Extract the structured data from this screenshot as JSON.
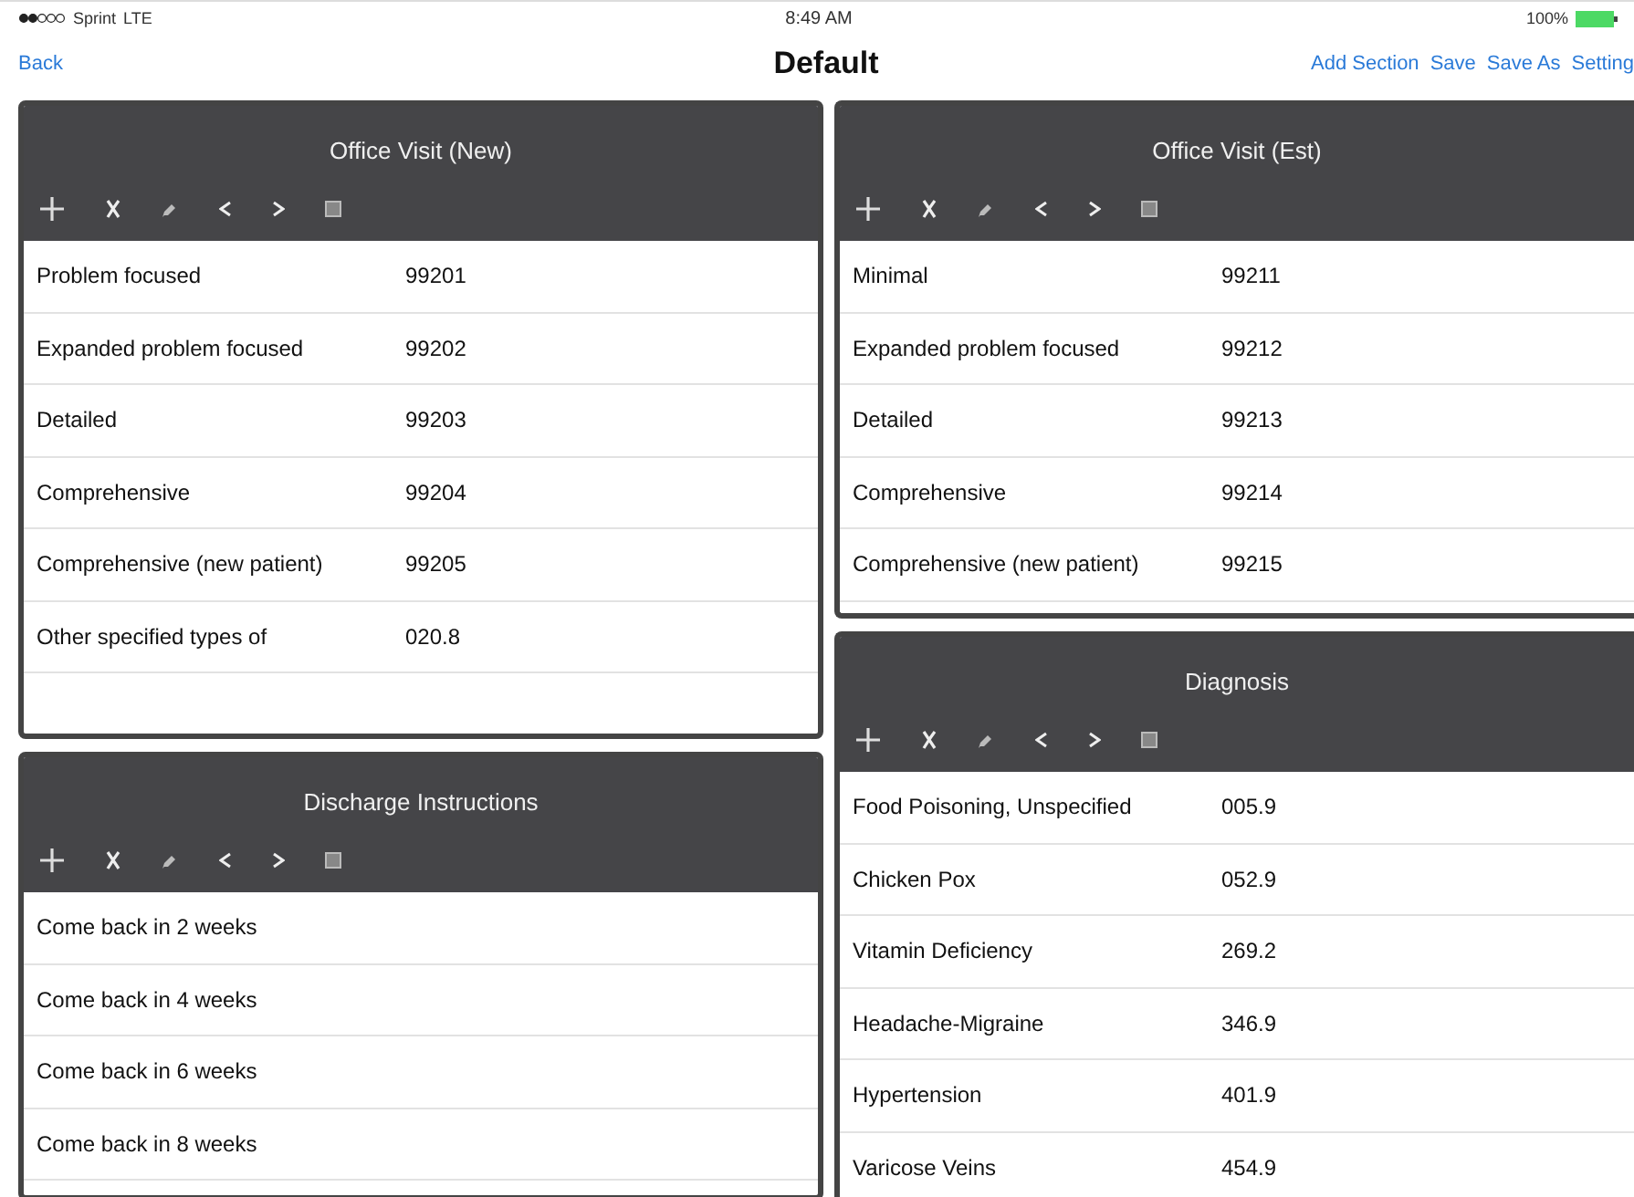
{
  "status_bar": {
    "carrier": "Sprint",
    "network": "LTE",
    "time": "8:49 AM",
    "battery": "100%"
  },
  "nav": {
    "back": "Back",
    "title": "Default",
    "actions": [
      "Add Section",
      "Save",
      "Save As",
      "Setting"
    ]
  },
  "columns": [
    {
      "panels": [
        {
          "title": "Office Visit (New)",
          "rows": [
            {
              "label": "Problem focused",
              "code": "99201"
            },
            {
              "label": "Expanded problem focused",
              "code": "99202"
            },
            {
              "label": "Detailed",
              "code": "99203"
            },
            {
              "label": "Comprehensive",
              "code": "99204"
            },
            {
              "label": "Comprehensive (new patient)",
              "code": "99205"
            },
            {
              "label": "Other specified types of",
              "code": "020.8"
            }
          ]
        },
        {
          "title": "Discharge Instructions",
          "rows": [
            {
              "label": "Come back in 2 weeks"
            },
            {
              "label": "Come back in 4 weeks"
            },
            {
              "label": "Come back in 6 weeks"
            },
            {
              "label": "Come back in 8 weeks"
            },
            {}
          ]
        }
      ]
    },
    {
      "panels": [
        {
          "title": "Office Visit (Est)",
          "rows": [
            {
              "label": "Minimal",
              "code": "99211"
            },
            {
              "label": "Expanded problem focused",
              "code": "99212"
            },
            {
              "label": "Detailed",
              "code": "99213"
            },
            {
              "label": "Comprehensive",
              "code": "99214"
            },
            {
              "label": "Comprehensive (new patient)",
              "code": "99215"
            }
          ]
        },
        {
          "title": "Diagnosis",
          "rows": [
            {
              "label": "Food Poisoning, Unspecified",
              "code": "005.9"
            },
            {
              "label": "Chicken Pox",
              "code": "052.9"
            },
            {
              "label": "Vitamin Deficiency",
              "code": "269.2"
            },
            {
              "label": "Headache-Migraine",
              "code": "346.9"
            },
            {
              "label": "Hypertension",
              "code": "401.9"
            },
            {
              "label": "Varicose Veins",
              "code": "454.9"
            }
          ]
        }
      ]
    }
  ]
}
